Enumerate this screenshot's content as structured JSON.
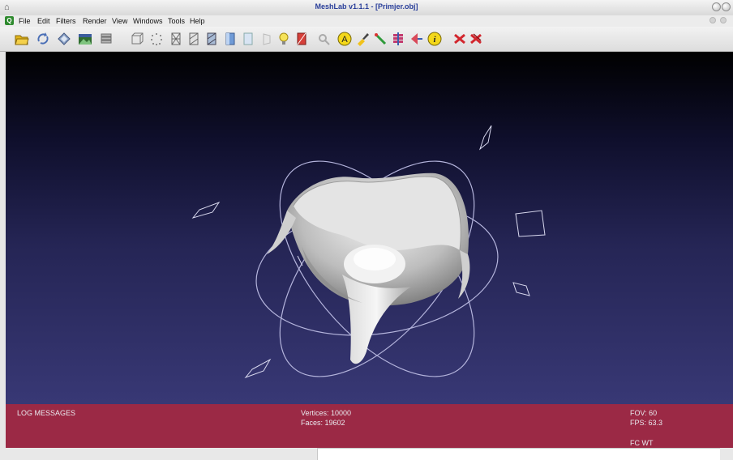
{
  "window": {
    "title": "MeshLab v1.1.1 - [Primjer.obj]"
  },
  "menu": [
    "File",
    "Edit",
    "Filters",
    "Render",
    "View",
    "Windows",
    "Tools",
    "Help"
  ],
  "toolbar": {
    "icons": [
      "open-folder-icon",
      "reload-icon",
      "save-icon",
      "snapshot-icon",
      "layers-icon",
      "bbox-icon",
      "points-icon",
      "wireframe-icon",
      "hidden-lines-icon",
      "flat-lines-icon",
      "flat-icon",
      "smooth-icon",
      "back-face-icon",
      "light-icon",
      "color-icon",
      "select-icon",
      "annotation-icon",
      "paint-icon",
      "pick-icon",
      "measure-icon",
      "align-icon",
      "info-icon",
      "delete-icon",
      "delete-all-icon"
    ]
  },
  "info": {
    "log_label": "LOG MESSAGES",
    "vertices": "Vertices: 10000",
    "faces": "Faces: 19602",
    "fov": "FOV: 60",
    "fps": "FPS:   63.3",
    "mode": "FC WT"
  },
  "colors": {
    "info_bar": "#9b2945",
    "viewport_top": "#000000",
    "viewport_bottom": "#383875",
    "title_text": "#2a3f9a"
  }
}
